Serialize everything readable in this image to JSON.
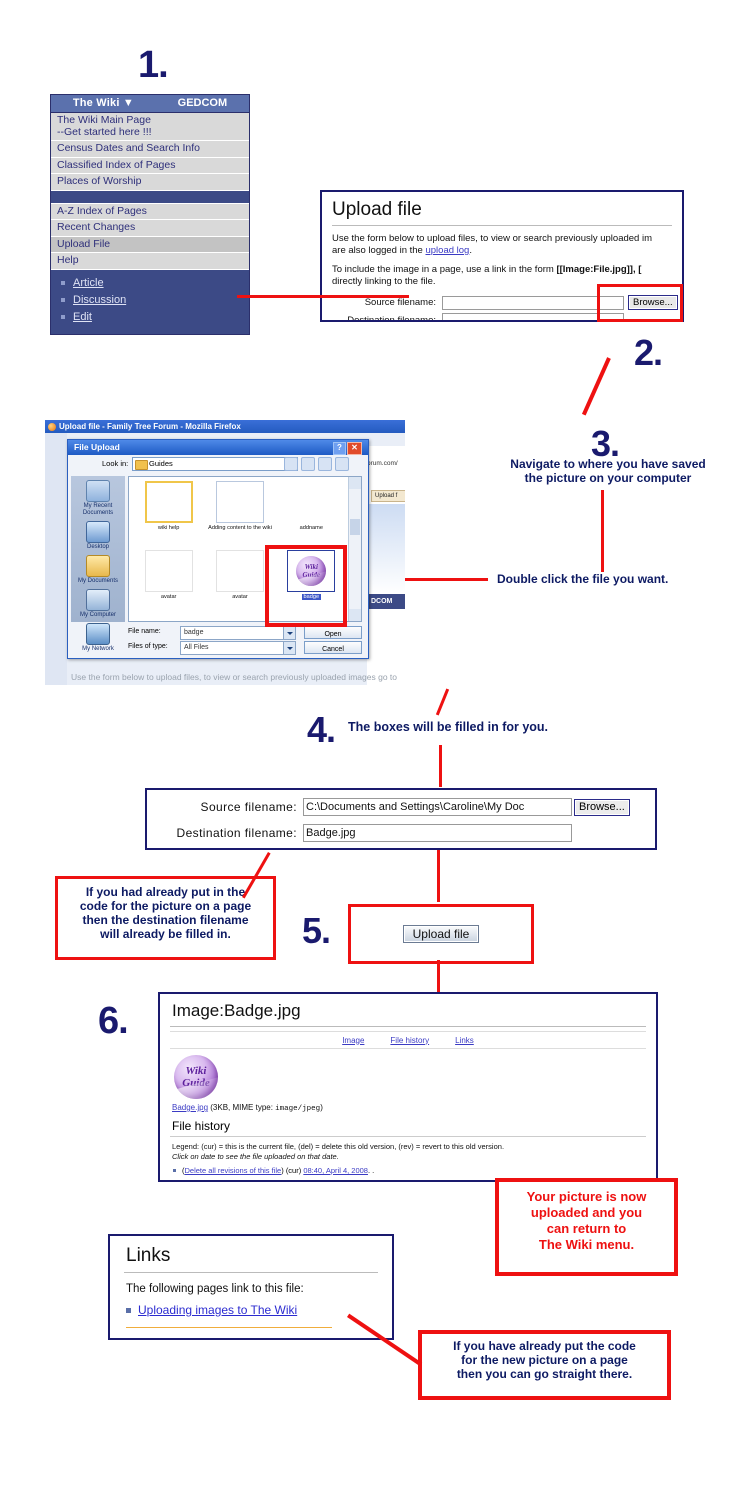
{
  "steps": {
    "s1": "1.",
    "s2": "2.",
    "s3": "3.",
    "s4": "4.",
    "s5": "5.",
    "s6": "6."
  },
  "wiki_menu": {
    "brand": "The Wiki",
    "brand_caret": "▼",
    "gedcom": "GEDCOM",
    "items": [
      "The Wiki Main Page\n--Get started here !!!",
      "Census Dates and Search Info",
      "Classified Index of Pages",
      "Places of Worship",
      "A-Z Index of Pages",
      "Recent Changes",
      "Upload File",
      "Help"
    ],
    "sub_items": [
      "Article",
      "Discussion",
      "Edit"
    ]
  },
  "upload_panel": {
    "title": "Upload file",
    "para1_a": "Use the form below to upload files, to view or search previously uploaded im",
    "para1_b": "are also logged in the ",
    "para1_link": "upload log",
    "para1_c": ".",
    "para2_a": "To include the image in a page, use a link in the form ",
    "para2_bold": "[[Image:File.jpg]]",
    "para2_b": ", [",
    "para2_c": "directly linking to the file.",
    "source_label": "Source filename:",
    "dest_label": "Destination filename:",
    "browse_label": "Browse...",
    "source_value": "",
    "dest_value": ""
  },
  "firefox": {
    "window_title": "Upload file - Family Tree Forum - Mozilla Firefox",
    "url_fragment": "orum.com/",
    "tab_label": "Upload f",
    "gedcom_strip": "DCOM",
    "page_text": "Use the form below to upload files, to view or search previously uploaded images go to",
    "dialog": {
      "title": "File Upload",
      "help_glyph": "?",
      "close_glyph": "✕",
      "lookin_label": "Look in:",
      "lookin_value": "Guides",
      "places": [
        "My Recent Documents",
        "Desktop",
        "My Documents",
        "My Computer",
        "My Network"
      ],
      "files": [
        {
          "name": "wiki help",
          "kind": "slides"
        },
        {
          "name": "Adding content to the wiki",
          "kind": "word"
        },
        {
          "name": "addname",
          "kind": "thin"
        },
        {
          "name": "avatar",
          "kind": "snowman"
        },
        {
          "name": "avatar",
          "kind": "snowman"
        },
        {
          "name": "badge",
          "kind": "badge",
          "selected": true
        }
      ],
      "badge_line1": "Wiki",
      "badge_line2": "Guide",
      "filename_label": "File name:",
      "filename_value": "badge",
      "filetype_label": "Files of type:",
      "filetype_value": "All Files",
      "open_label": "Open",
      "cancel_label": "Cancel"
    }
  },
  "annotations": {
    "navigate": "Navigate to where you have saved\nthe picture on your computer",
    "double_click": "Double click the file you want.",
    "boxes_filled": "The boxes will be filled in for you.",
    "already_code": "If you had already put in the\ncode for the picture on a page\nthen the destination filename\nwill already be filled in.",
    "picture_uploaded": "Your picture is now\nuploaded and  you\ncan return to\nThe Wiki menu.",
    "already_code2": "If you have already put the code\nfor the new picture on a page\nthen you can go straight there."
  },
  "form4": {
    "source_label": "Source filename:",
    "source_value": "C:\\Documents and Settings\\Caroline\\My Doc",
    "dest_label": "Destination filename:",
    "dest_value": "Badge.jpg",
    "browse_label": "Browse..."
  },
  "step5": {
    "upload_button": "Upload file"
  },
  "image_page": {
    "title": "Image:Badge.jpg",
    "nav": [
      "Image",
      "File history",
      "Links"
    ],
    "badge_line1": "Wiki",
    "badge_line2": "Guide",
    "file_link": "Badge.jpg",
    "file_meta_a": " (3KB, MIME type: ",
    "file_meta_code": "image/jpeg",
    "file_meta_b": ")",
    "history_heading": "File history",
    "legend_line1": "Legend: (cur) = this is the current file, (del) = delete this old version, (rev) = revert to this old version.",
    "legend_line2": "Click on date to see the file uploaded on that date.",
    "rev_del": "Delete all revisions of this file",
    "rev_cur": "(cur)",
    "rev_date": "08:40, April 4, 2008",
    "rev_tail": ". ."
  },
  "links_box": {
    "title": "Links",
    "intro": "The following pages link to this file:",
    "link": "Uploading images to The Wiki"
  },
  "colors": {
    "annotation_navy": "#0d1a63",
    "callout_red": "#ee1111",
    "wiki_header_blue": "#5b71ad",
    "wiki_dark_blue": "#3c4a86",
    "link_blue": "#3b3bc4"
  }
}
